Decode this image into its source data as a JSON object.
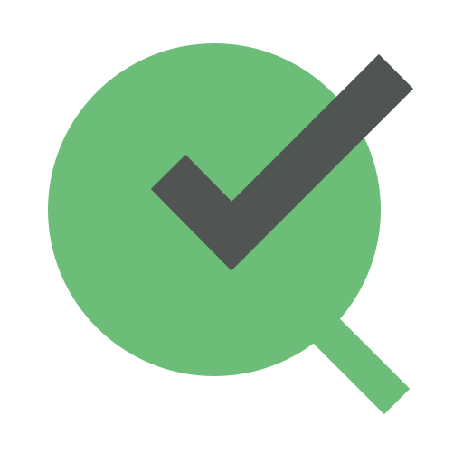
{
  "icon": {
    "name": "search-check-icon",
    "colors": {
      "background": "#ffffff",
      "magnifier": "#6cbd77",
      "checkmark": "#505453"
    }
  }
}
